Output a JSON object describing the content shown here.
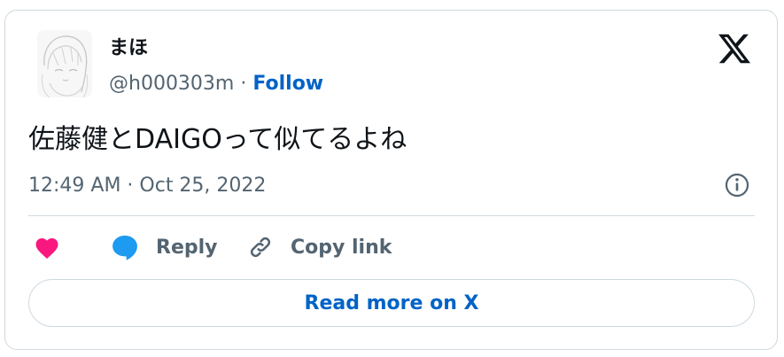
{
  "author": {
    "name": "まほ",
    "handle": "@h000303m",
    "separator": "·",
    "follow_label": "Follow"
  },
  "tweet": {
    "text": "佐藤健とDAIGOって似てるよね",
    "timestamp": "12:49 AM · Oct 25, 2022"
  },
  "actions": {
    "reply_label": "Reply",
    "copy_link_label": "Copy link"
  },
  "read_more_label": "Read more on X",
  "icons": {
    "brand": "x-logo-icon",
    "info": "info-icon",
    "like": "heart-icon",
    "reply": "speech-bubble-icon",
    "copy": "link-icon"
  },
  "colors": {
    "follow": "#0063c6",
    "heart": "#f91880",
    "reply": "#1d9bf0",
    "muted_text": "#536471",
    "border": "#cfd9de"
  }
}
